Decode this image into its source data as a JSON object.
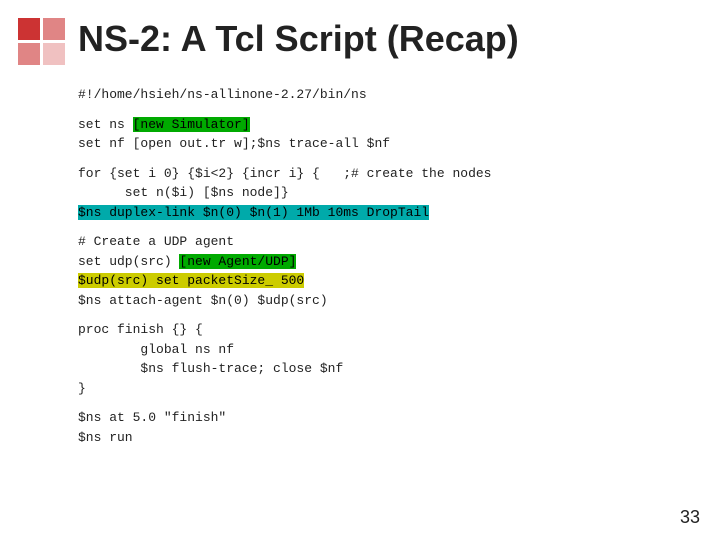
{
  "header": {
    "title": "NS-2: A Tcl Script (Recap)"
  },
  "code": {
    "shebang": "#!/home/hsieh/ns-allinone-2.27/bin/ns",
    "block1": [
      "set ns [new Simulator]",
      "set nf [open out.tr w];$ns trace-all $nf"
    ],
    "block2": [
      "for {set i 0} {$i<2} {incr i} {   ;# create the nodes",
      "      set n($i) [$ns node]}",
      "$ns duplex-link $n(0) $n(1) 1Mb 10ms DropTail"
    ],
    "block3": [
      "# Create a UDP agent",
      "set udp(src) [new Agent/UDP]",
      "$udp(src) set packetSize_ 500",
      "$ns attach-agent $n(0) $udp(src)"
    ],
    "block4": [
      "proc finish {} {",
      "        global ns nf",
      "        $ns flush-trace; close $nf",
      "}"
    ],
    "block5": [
      "$ns at 5.0 \"finish\"",
      "$ns run"
    ]
  },
  "page_number": "33",
  "highlights": {
    "new_simulator": "[new Simulator]",
    "duplex_link_line": "$ns duplex-link $n(0) $n(1) 1Mb 10ms DropTail",
    "new_agent_udp": "[new Agent/UDP]",
    "packet_size_line": "$udp(src) set packetSize_ 500"
  }
}
